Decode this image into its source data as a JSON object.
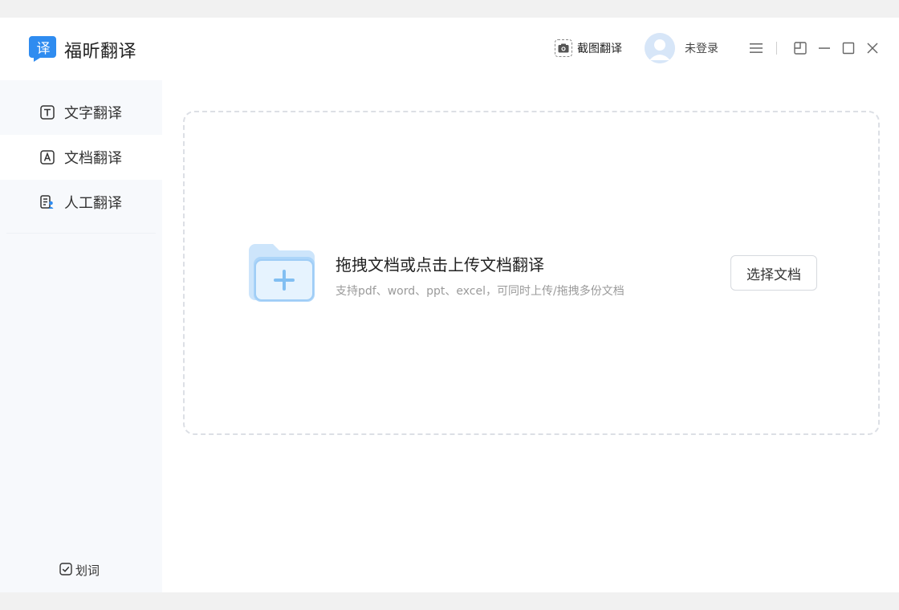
{
  "app": {
    "logo_char": "译",
    "name": "福昕翻译",
    "brand_color": "#2f8cf0"
  },
  "titlebar": {
    "screenshot_label": "截图翻译",
    "login_label": "未登录"
  },
  "sidebar": {
    "items": [
      {
        "label": "文字翻译",
        "icon": "text-t-icon",
        "active": false
      },
      {
        "label": "文档翻译",
        "icon": "doc-a-icon",
        "active": true
      },
      {
        "label": "人工翻译",
        "icon": "human-doc-icon",
        "active": false
      }
    ],
    "word_pick_label": "划词"
  },
  "main": {
    "title": "拖拽文档或点击上传文档翻译",
    "subtitle": "支持pdf、word、ppt、excel，可同时上传/拖拽多份文档",
    "select_button": "选择文档"
  }
}
